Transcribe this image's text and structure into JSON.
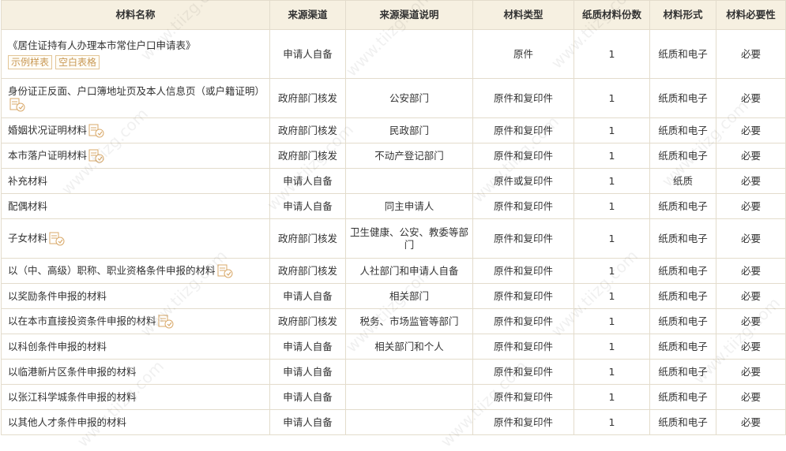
{
  "headers": [
    "材料名称",
    "来源渠道",
    "来源渠道说明",
    "材料类型",
    "纸质材料份数",
    "材料形式",
    "材料必要性"
  ],
  "sample_button": "示例样表",
  "blank_button": "空白表格",
  "rows": [
    {
      "name": "《居住证持有人办理本市常住户口申请表》",
      "channel": "申请人自备",
      "desc": "",
      "type": "原件",
      "copies": "1",
      "form": "纸质和电子",
      "need": "必要",
      "buttons": true,
      "tag": false
    },
    {
      "name": "身份证正反面、户口簿地址页及本人信息页（或户籍证明）",
      "channel": "政府部门核发",
      "desc": "公安部门",
      "type": "原件和复印件",
      "copies": "1",
      "form": "纸质和电子",
      "need": "必要",
      "buttons": false,
      "tag": true
    },
    {
      "name": "婚姻状况证明材料",
      "channel": "政府部门核发",
      "desc": "民政部门",
      "type": "原件和复印件",
      "copies": "1",
      "form": "纸质和电子",
      "need": "必要",
      "buttons": false,
      "tag": true
    },
    {
      "name": "本市落户证明材料",
      "channel": "政府部门核发",
      "desc": "不动产登记部门",
      "type": "原件和复印件",
      "copies": "1",
      "form": "纸质和电子",
      "need": "必要",
      "buttons": false,
      "tag": true
    },
    {
      "name": "补充材料",
      "channel": "申请人自备",
      "desc": "",
      "type": "原件或复印件",
      "copies": "1",
      "form": "纸质",
      "need": "必要",
      "buttons": false,
      "tag": false
    },
    {
      "name": "配偶材料",
      "channel": "申请人自备",
      "desc": "同主申请人",
      "type": "原件和复印件",
      "copies": "1",
      "form": "纸质和电子",
      "need": "必要",
      "buttons": false,
      "tag": false
    },
    {
      "name": "子女材料",
      "channel": "政府部门核发",
      "desc": "卫生健康、公安、教委等部门",
      "type": "原件和复印件",
      "copies": "1",
      "form": "纸质和电子",
      "need": "必要",
      "buttons": false,
      "tag": true
    },
    {
      "name": "以（中、高级）职称、职业资格条件申报的材料",
      "channel": "政府部门核发",
      "desc": "人社部门和申请人自备",
      "type": "原件和复印件",
      "copies": "1",
      "form": "纸质和电子",
      "need": "必要",
      "buttons": false,
      "tag": true
    },
    {
      "name": "以奖励条件申报的材料",
      "channel": "申请人自备",
      "desc": "相关部门",
      "type": "原件和复印件",
      "copies": "1",
      "form": "纸质和电子",
      "need": "必要",
      "buttons": false,
      "tag": false
    },
    {
      "name": "以在本市直接投资条件申报的材料",
      "channel": "政府部门核发",
      "desc": "税务、市场监管等部门",
      "type": "原件和复印件",
      "copies": "1",
      "form": "纸质和电子",
      "need": "必要",
      "buttons": false,
      "tag": true
    },
    {
      "name": "以科创条件申报的材料",
      "channel": "申请人自备",
      "desc": "相关部门和个人",
      "type": "原件和复印件",
      "copies": "1",
      "form": "纸质和电子",
      "need": "必要",
      "buttons": false,
      "tag": false
    },
    {
      "name": "以临港新片区条件申报的材料",
      "channel": "申请人自备",
      "desc": "",
      "type": "原件和复印件",
      "copies": "1",
      "form": "纸质和电子",
      "need": "必要",
      "buttons": false,
      "tag": false
    },
    {
      "name": "以张江科学城条件申报的材料",
      "channel": "申请人自备",
      "desc": "",
      "type": "原件和复印件",
      "copies": "1",
      "form": "纸质和电子",
      "need": "必要",
      "buttons": false,
      "tag": false
    },
    {
      "name": "以其他人才条件申报的材料",
      "channel": "申请人自备",
      "desc": "",
      "type": "原件和复印件",
      "copies": "1",
      "form": "纸质和电子",
      "need": "必要",
      "buttons": false,
      "tag": false
    }
  ],
  "watermark": "www.tiizg.com",
  "colors": {
    "header_bg": "#f6f0e1",
    "border": "#e3dccc",
    "button": "#c99955",
    "tag": "#d9a96a"
  },
  "icons": {
    "tag": "exempt-document-icon"
  }
}
